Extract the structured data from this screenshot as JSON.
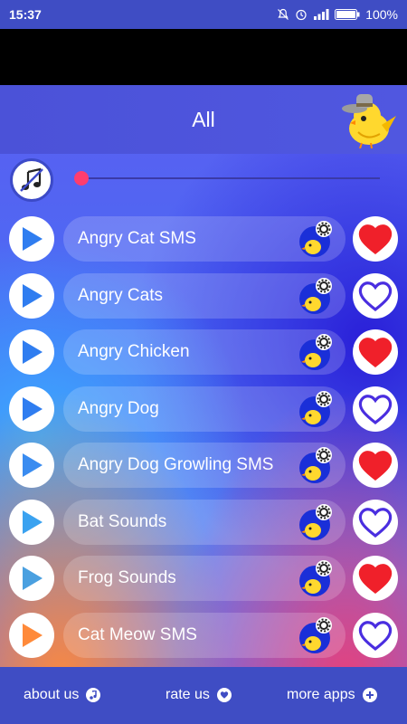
{
  "status_bar": {
    "time": "15:37",
    "battery": "100%"
  },
  "header": {
    "title": "All"
  },
  "player": {
    "progress": 0.0
  },
  "sounds": [
    {
      "label": "Angry Cat SMS",
      "favorite": true
    },
    {
      "label": "Angry Cats",
      "favorite": false
    },
    {
      "label": "Angry Chicken",
      "favorite": true
    },
    {
      "label": "Angry Dog",
      "favorite": false
    },
    {
      "label": "Angry Dog Growling SMS",
      "favorite": true
    },
    {
      "label": "Bat Sounds",
      "favorite": false
    },
    {
      "label": "Frog Sounds",
      "favorite": true
    },
    {
      "label": "Cat Meow SMS",
      "favorite": false
    }
  ],
  "footer": {
    "about_label": "about us",
    "rate_label": "rate us",
    "more_label": "more apps"
  },
  "colors": {
    "accent": "#3f4dc4",
    "heart_red": "#f0202a",
    "heart_outline": "#4a2ee0",
    "seek_thumb": "#ff3d6e"
  },
  "icons": {
    "play": "play-icon",
    "heart": "heart-icon",
    "music_off": "music-off-icon",
    "settings": "gear-icon",
    "bird": "bird-icon"
  }
}
